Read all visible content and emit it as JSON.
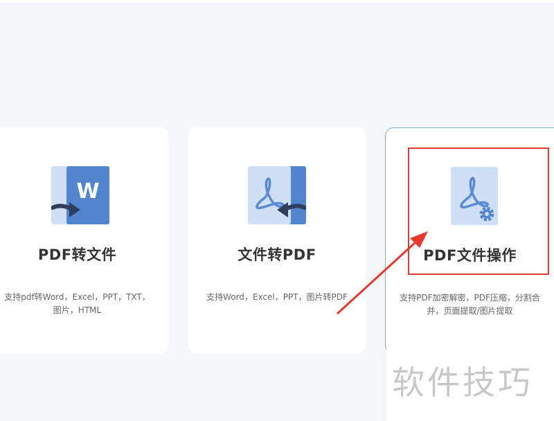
{
  "cards": [
    {
      "title": "PDF转文件",
      "desc_line1": "支持pdf转Word，Excel，PPT，TXT，",
      "desc_line2": "图片，HTML",
      "icon": "pdf-to-word-icon"
    },
    {
      "title": "文件转PDF",
      "desc_line1": "支持Word，Excel，PPT，图片转PDF",
      "desc_line2": "",
      "icon": "file-to-pdf-icon"
    },
    {
      "title": "PDF文件操作",
      "desc_line1": "支持PDF加密解密，PDF压缩，分割合",
      "desc_line2": "并，页面提取/图片提取",
      "icon": "pdf-settings-icon"
    }
  ],
  "watermark": "软件技巧",
  "colors": {
    "icon_light": "#cfdff5",
    "icon_dark": "#5186cf",
    "icon_symbol": "#5a8ad2",
    "arrow_dark": "#2f3e5c",
    "annotation_red": "#e5392e",
    "active_border": "#7fb0d8"
  }
}
